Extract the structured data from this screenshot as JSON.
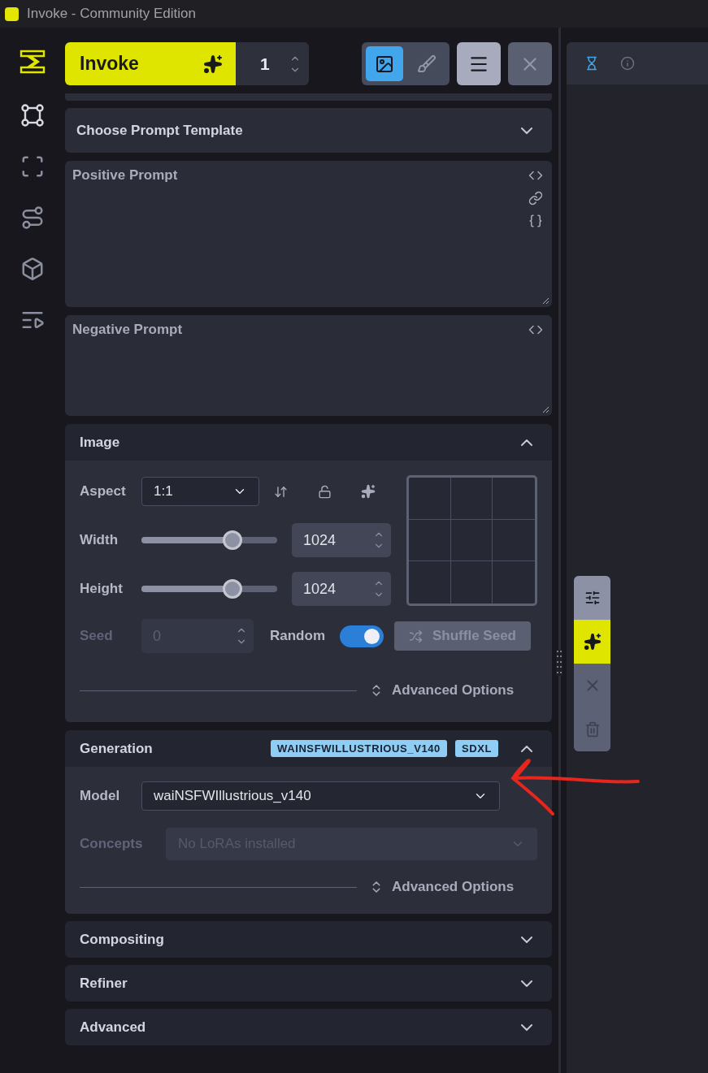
{
  "window": {
    "title": "Invoke - Community Edition"
  },
  "sidebar": {
    "items": [
      {
        "kind": "nodes",
        "selected": true
      },
      {
        "kind": "frame",
        "selected": false
      },
      {
        "kind": "route",
        "selected": false
      },
      {
        "kind": "box",
        "selected": false
      },
      {
        "kind": "queue",
        "selected": false
      }
    ]
  },
  "toolbar": {
    "invoke_label": "Invoke",
    "iterations": "1",
    "views": [
      {
        "kind": "image",
        "selected": true
      },
      {
        "kind": "brush",
        "selected": false
      }
    ]
  },
  "prompt_template": {
    "label": "Choose Prompt Template"
  },
  "positive_prompt": {
    "placeholder": "Positive Prompt"
  },
  "negative_prompt": {
    "placeholder": "Negative Prompt"
  },
  "image": {
    "title": "Image",
    "expanded": true,
    "aspect_label": "Aspect",
    "aspect_value": "1:1",
    "sliders": [
      {
        "label": "Width",
        "level": 0.67,
        "value": "1024"
      },
      {
        "label": "Height",
        "level": 0.67,
        "value": "1024"
      }
    ],
    "seed": {
      "label": "Seed",
      "value": "0",
      "disabled": true
    },
    "random": {
      "label": "Random",
      "on": true
    },
    "shuffle": {
      "label": "Shuffle Seed",
      "disabled": true
    },
    "advanced": "Advanced Options"
  },
  "generation": {
    "title": "Generation",
    "expanded": true,
    "badges": [
      "WAINSFWILLUSTRIOUS_V140",
      "SDXL"
    ],
    "model_label": "Model",
    "model_value": "waiNSFWIllustrious_v140",
    "concepts_label": "Concepts",
    "concepts_placeholder": "No LoRAs installed",
    "concepts_disabled": true,
    "advanced": "Advanced Options"
  },
  "sections": [
    {
      "title": "Compositing",
      "expanded": false
    },
    {
      "title": "Refiner",
      "expanded": false
    },
    {
      "title": "Advanced",
      "expanded": false
    }
  ],
  "right_panel": {
    "tabs": [
      {
        "kind": "queue",
        "selected": true
      },
      {
        "kind": "info",
        "selected": false
      }
    ]
  },
  "floating_toolbar": [
    {
      "kind": "settings",
      "selected": false
    },
    {
      "kind": "invoke",
      "selected": true
    },
    {
      "kind": "cancel",
      "selected": false
    },
    {
      "kind": "clear",
      "selected": false
    }
  ]
}
